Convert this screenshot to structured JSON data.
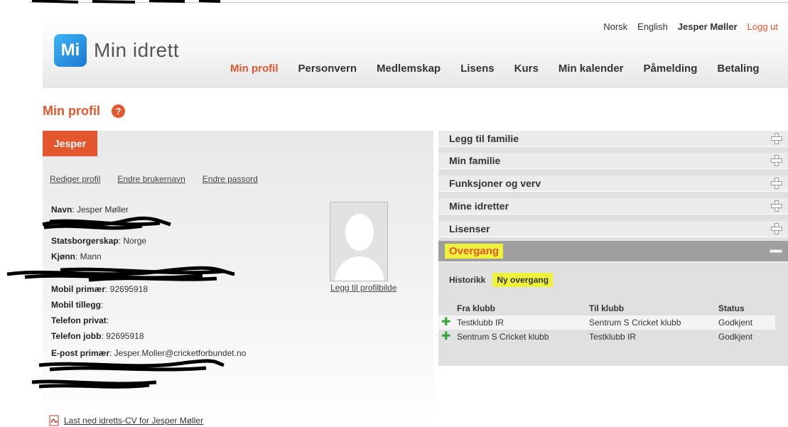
{
  "header": {
    "lang_no": "Norsk",
    "lang_en": "English",
    "user_name": "Jesper Møller",
    "logout": "Logg ut",
    "logo_mark": "Mi",
    "logo_text": "Min idrett",
    "nav": [
      "Min profil",
      "Personvern",
      "Medlemskap",
      "Lisens",
      "Kurs",
      "Min kalender",
      "Påmelding",
      "Betaling"
    ]
  },
  "page": {
    "title": "Min profil",
    "help_glyph": "?"
  },
  "profile": {
    "name_tab": "Jesper",
    "links": [
      "Rediger profil",
      "Endre brukernavn",
      "Endre passord"
    ],
    "fields": [
      {
        "label": "Navn",
        "value": ": Jesper Møller"
      },
      {
        "label": "Statsborgerskap",
        "value": ": Norge"
      },
      {
        "label": "Kjønn",
        "value": ": Mann"
      },
      {
        "label": "Mobil primær",
        "value": ": 92695918"
      },
      {
        "label": "Mobil tillegg",
        "value": ":"
      },
      {
        "label": "Telefon privat",
        "value": ":"
      },
      {
        "label": "Telefon jobb",
        "value": ": 92695918"
      },
      {
        "label": "E-post primær",
        "value": ": Jesper.Moller@cricketforbundet.no"
      }
    ],
    "avatar_link": "Legg til profilbilde",
    "cv_link": "Last ned idretts-CV for Jesper Møller"
  },
  "accordion": {
    "items": [
      "Legg til familie",
      "Min familie",
      "Funksjoner og verv",
      "Mine idretter",
      "Lisenser"
    ],
    "open_item": "Overgang",
    "history_label": "Historikk",
    "new_transfer": "Ny overgang",
    "table": {
      "headers": [
        "Fra klubb",
        "Til klubb",
        "Status"
      ],
      "rows": [
        [
          "Testklubb IR",
          "Sentrum S Cricket klubb",
          "Godkjent"
        ],
        [
          "Sentrum S Cricket klubb",
          "Testklubb IR",
          "Godkjent"
        ]
      ]
    }
  },
  "colors": {
    "accent": "#e4572e",
    "highlight": "#eef23c",
    "green": "#3aa33a"
  }
}
